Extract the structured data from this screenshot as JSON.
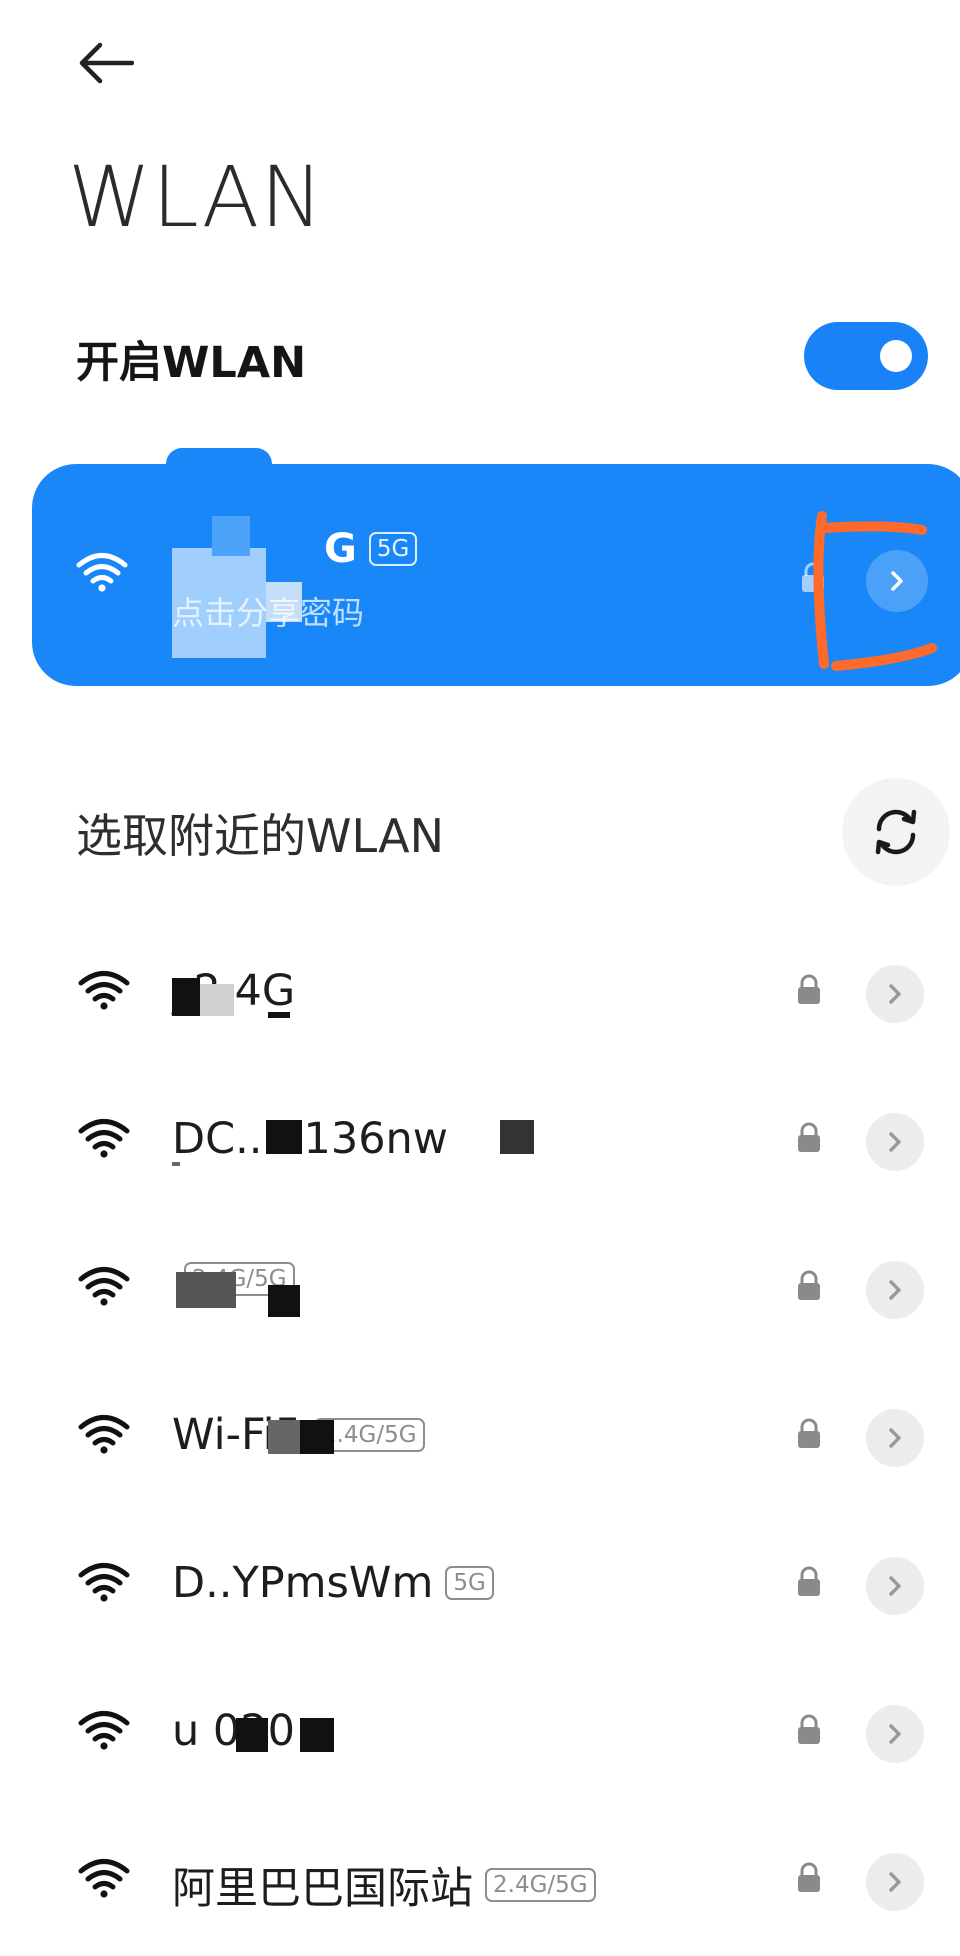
{
  "header": {
    "title": "WLAN"
  },
  "wlan_toggle": {
    "label": "开启WLAN",
    "on": true
  },
  "connected": {
    "ssid_suffix": "G",
    "band": "5G",
    "subtitle": "点击分享密码"
  },
  "nearby": {
    "section_title": "选取附近的WLAN",
    "networks": [
      {
        "ssid": "_2.4G",
        "band": ""
      },
      {
        "ssid": "DC..   . 136nw",
        "band": ""
      },
      {
        "ssid": "",
        "band": "2.4G/5G"
      },
      {
        "ssid": "Wi-Fi5",
        "band": "2.4G/5G"
      },
      {
        "ssid": "D..YPmsWm",
        "band": "5G"
      },
      {
        "ssid": "u  020",
        "band": ""
      },
      {
        "ssid": "阿里巴巴国际站",
        "band": "2.4G/5G"
      }
    ]
  },
  "colors": {
    "accent": "#1a82f7",
    "card": "#1987f7",
    "annotation": "#ff6a2a"
  },
  "icons": [
    "back-arrow-icon",
    "wifi-icon",
    "lock-icon",
    "chevron-right-icon",
    "refresh-icon"
  ]
}
